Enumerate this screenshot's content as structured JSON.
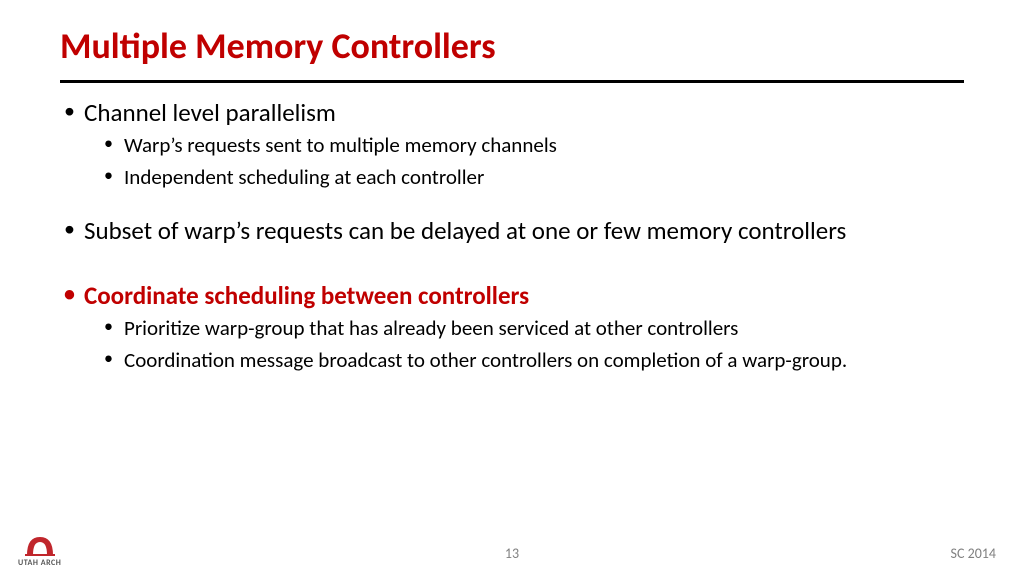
{
  "title": "Multiple Memory Controllers",
  "bullets": {
    "b1": "Channel level parallelism",
    "b1a": "Warp’s requests sent to multiple memory channels",
    "b1b": "Independent scheduling at each controller",
    "b2": "Subset of warp’s requests can be delayed at one or few memory controllers",
    "b3": "Coordinate scheduling between controllers",
    "b3a": "Prioritize warp-group that has already been serviced at other controllers",
    "b3b": "Coordination message broadcast to other controllers on completion of a warp-group."
  },
  "pagenum": "13",
  "conference": "SC 2014",
  "logo_text": "UTAH ARCH"
}
